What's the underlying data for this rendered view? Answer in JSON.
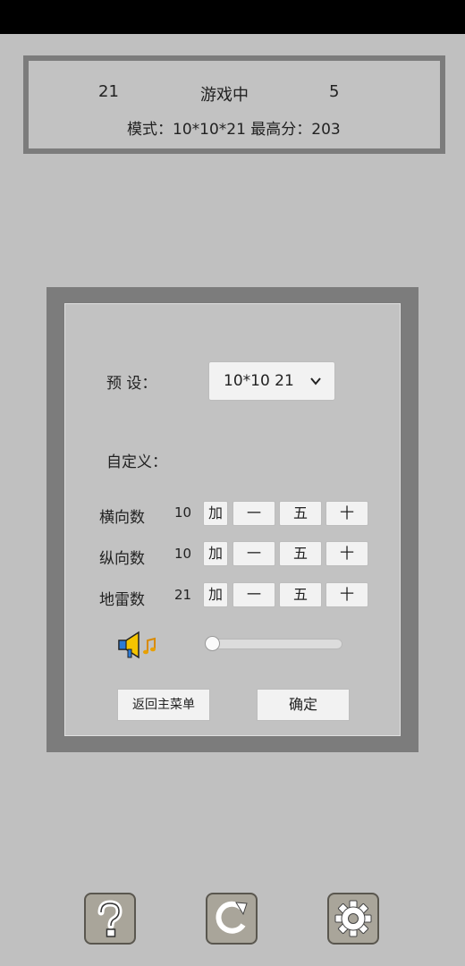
{
  "scoreboard": {
    "left_value": "21",
    "status": "游戏中",
    "right_value": "5",
    "mode_line": "模式：10*10*21   最高分：203"
  },
  "dialog": {
    "preset_label": "预   设：",
    "preset_value": "10*10  21",
    "custom_label": "自定义：",
    "rows": [
      {
        "label": "横向数",
        "value": "10"
      },
      {
        "label": "纵向数",
        "value": "10"
      },
      {
        "label": "地雷数",
        "value": "21"
      }
    ],
    "buttons": {
      "add": "加",
      "one": "一",
      "five": "五",
      "ten": "十"
    },
    "volume_level": 0,
    "back_label": "返回主菜单",
    "confirm_label": "确定"
  },
  "toolbar": {
    "help_icon": "question-icon",
    "restart_icon": "restart-icon",
    "settings_icon": "gear-icon"
  }
}
